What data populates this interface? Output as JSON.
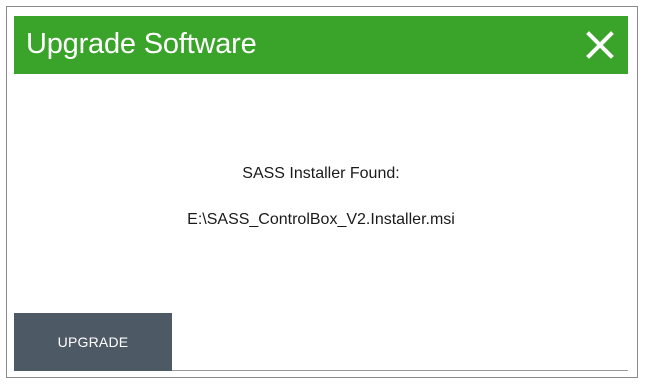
{
  "dialog": {
    "title": "Upgrade Software",
    "close_icon": "close-icon",
    "message_label": "SASS Installer Found:",
    "installer_path": "E:\\SASS_ControlBox_V2.Installer.msi",
    "upgrade_label": "UPGRADE"
  },
  "colors": {
    "titlebar": "#3aa32a",
    "button": "#4e5966",
    "title_text": "#ffffff"
  }
}
